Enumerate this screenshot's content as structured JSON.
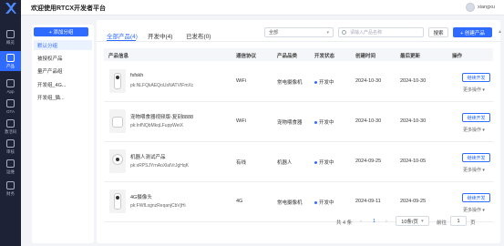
{
  "header": {
    "title": "欢迎使用RTCX开发者平台",
    "user": "xiangxu"
  },
  "rail": {
    "items": [
      {
        "label": "概览",
        "icon": "dashboard-icon"
      },
      {
        "label": "产品",
        "icon": "product-icon",
        "active": true
      },
      {
        "label": "App",
        "icon": "app-icon"
      },
      {
        "label": "OTA",
        "icon": "ota-icon"
      },
      {
        "label": "激活码",
        "icon": "code-icon"
      },
      {
        "label": "审核",
        "icon": "review-icon"
      },
      {
        "label": "运维",
        "icon": "ops-icon"
      },
      {
        "label": "财务",
        "icon": "finance-icon"
      }
    ]
  },
  "categories": {
    "add_label": "+ 添加分组",
    "items": [
      {
        "label": "默认分组",
        "active": true
      },
      {
        "label": "被授权产品"
      },
      {
        "label": "量产产品组"
      },
      {
        "label": "开发组_4G..."
      },
      {
        "label": "开发组_猫..."
      }
    ]
  },
  "tabs": [
    {
      "label": "全部产品(4)",
      "active": true
    },
    {
      "label": "开发中(4)"
    },
    {
      "label": "已发布(0)"
    }
  ],
  "filters": {
    "select_value": "全部",
    "search_placeholder": "请输入产品名称",
    "search_button": "搜索",
    "create_button": "+ 创建产品"
  },
  "table": {
    "headers": [
      "产品信息",
      "通信协议",
      "产品品类",
      "开发状态",
      "创建时间",
      "最后更新",
      "操作"
    ],
    "rows": [
      {
        "name": "fsfskh",
        "pk": "pk:NLFQkAEQoUsNATVIFmXc",
        "protocol": "WiFi",
        "category": "常电摄像机",
        "status": "开发中",
        "created": "2024-10-30",
        "updated": "2024-10-30"
      },
      {
        "name": "宠物喂食器视频版-复刻8888",
        "pk": "pk:InfNQbMkqLFuppWeiX",
        "protocol": "WiFi",
        "category": "宠物喂食器",
        "status": "开发中",
        "created": "2024-10-30",
        "updated": "2024-10-30"
      },
      {
        "name": "机器人测试产品",
        "pk": "pk:xRPSJYrnAoXlalVrJgHqK",
        "protocol": "有线",
        "category": "机器人",
        "status": "开发中",
        "created": "2024-09-25",
        "updated": "2024-10-05"
      },
      {
        "name": "4G摄像头",
        "pk": "pk:FWfLxgnzReqanjCbVjHi",
        "protocol": "4G",
        "category": "常电摄像机",
        "status": "开发中",
        "created": "2024-09-11",
        "updated": "2024-09-25"
      }
    ],
    "action_label": "继续开发",
    "more_label": "更多操作 ▾"
  },
  "pagination": {
    "total": "共 4 条",
    "prev": "‹",
    "current": "1",
    "next": "›",
    "page_size": "10条/页",
    "goto_label": "前往",
    "goto_value": "1",
    "page_unit": "页"
  },
  "colors": {
    "accent": "#2f6bff",
    "rail_bg": "#1d2236"
  }
}
